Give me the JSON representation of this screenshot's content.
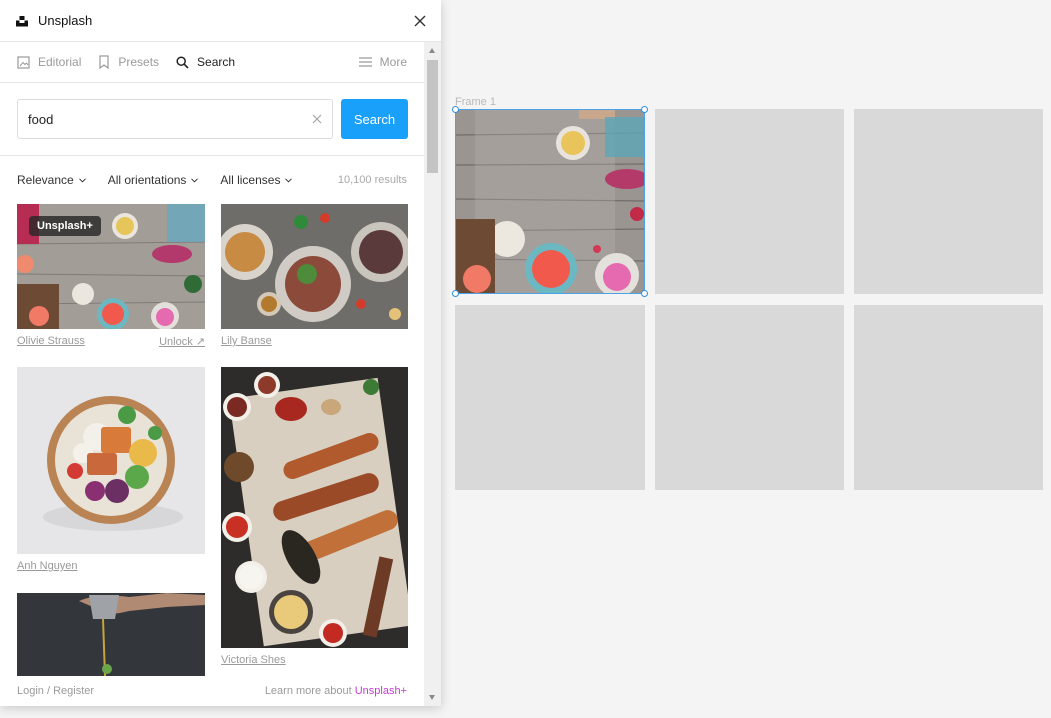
{
  "plugin": {
    "title": "Unsplash",
    "tabs": [
      {
        "label": "Editorial",
        "icon": "image-icon"
      },
      {
        "label": "Presets",
        "icon": "bookmark-icon"
      },
      {
        "label": "Search",
        "icon": "search-icon"
      }
    ],
    "more_label": "More",
    "search": {
      "value": "food",
      "button_label": "Search"
    },
    "filters": {
      "sort": "Relevance",
      "orientation": "All orientations",
      "license": "All licenses",
      "results": "10,100 results"
    },
    "photos": [
      {
        "credit": "Olivie Strauss",
        "badge": "Unsplash+",
        "action": "Unlock ↗"
      },
      {
        "credit": "Lily Banse"
      },
      {
        "credit": "Anh Nguyen"
      },
      {
        "credit": "Victoria Shes"
      },
      {
        "credit": ""
      }
    ],
    "footer": {
      "login": "Login / Register",
      "learn_prefix": "Learn more about ",
      "learn_link": "Unsplash+"
    }
  },
  "canvas": {
    "frame_label": "Frame 1"
  },
  "colors": {
    "accent": "#18a0fb",
    "unsplash_plus": "#c63bd6",
    "selection": "#2d8fe0",
    "placeholder_tile": "#d9d9d9"
  }
}
